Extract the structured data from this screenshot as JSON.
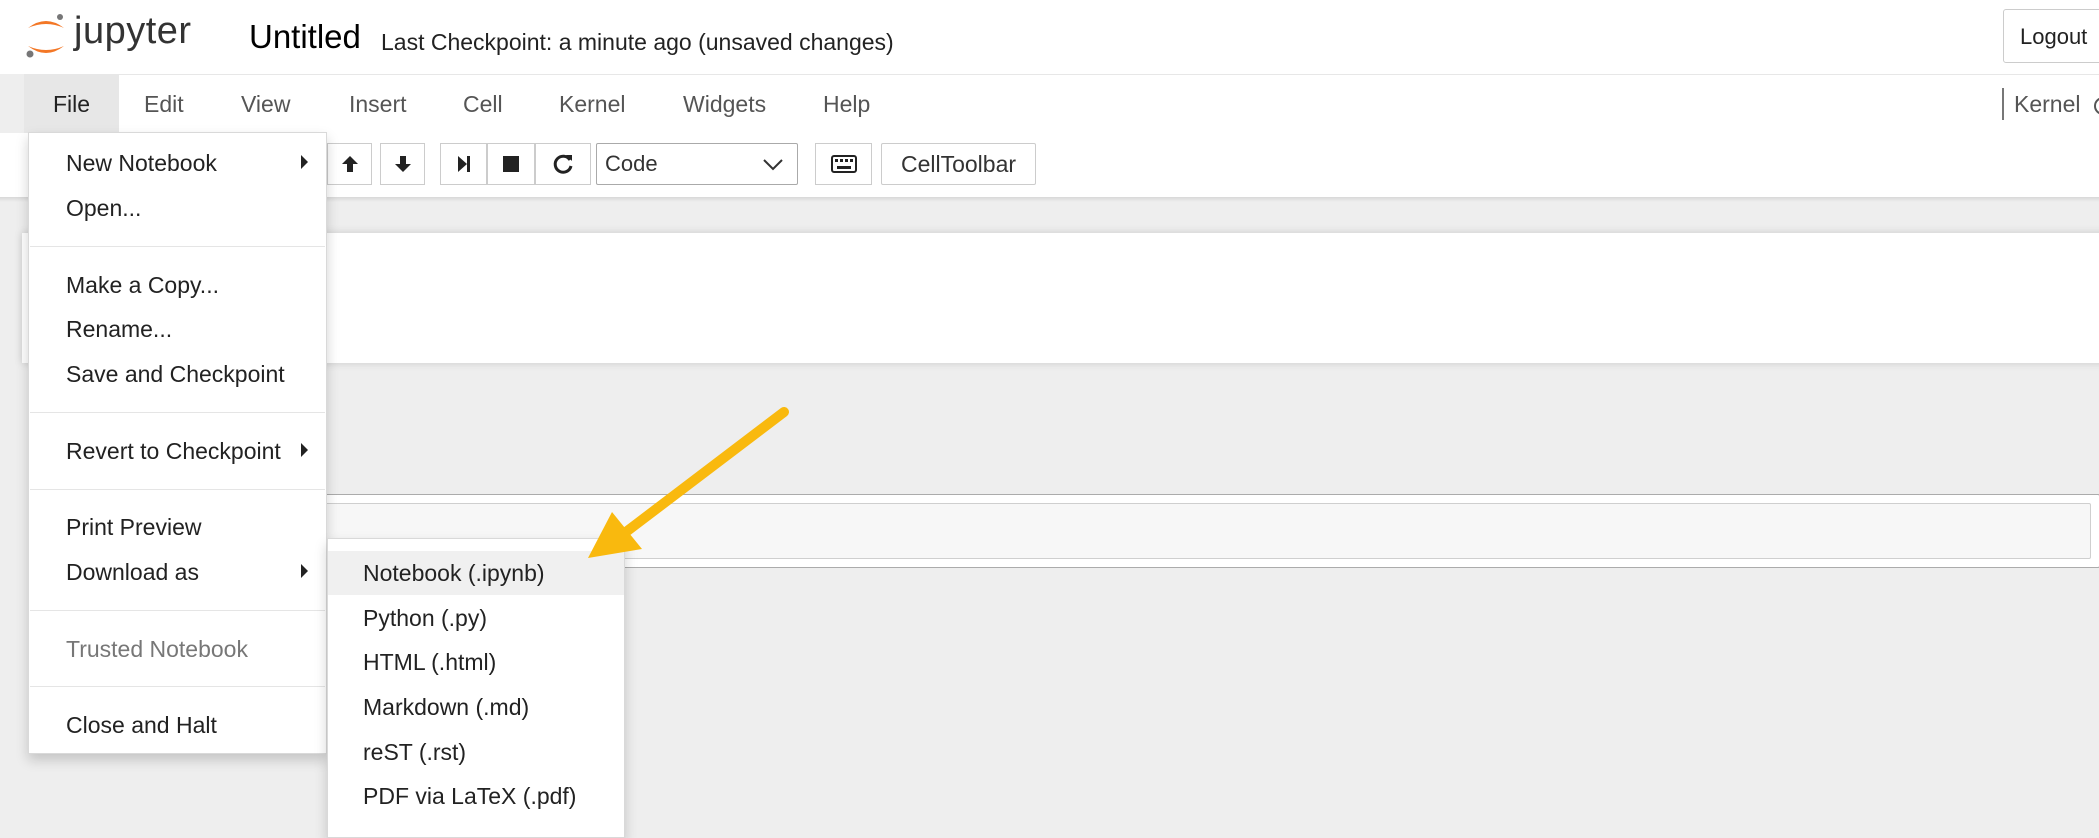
{
  "header": {
    "logo_text": "jupyter",
    "notebook_title": "Untitled",
    "checkpoint_status": "Last Checkpoint: a minute ago (unsaved changes)",
    "logout_label": "Logout"
  },
  "menubar": {
    "items": [
      {
        "label": "File",
        "active": true
      },
      {
        "label": "Edit"
      },
      {
        "label": "View"
      },
      {
        "label": "Insert"
      },
      {
        "label": "Cell"
      },
      {
        "label": "Kernel"
      },
      {
        "label": "Widgets"
      },
      {
        "label": "Help"
      }
    ],
    "kernel_label": "Kernel"
  },
  "toolbar": {
    "buttons": [
      "arrow-up-icon",
      "arrow-down-icon",
      "step-forward-icon",
      "stop-icon",
      "restart-icon",
      "keyboard-icon"
    ],
    "cell_type": "Code",
    "celltoolbar_label": "CellToolbar"
  },
  "file_menu": {
    "items": [
      {
        "label": "New Notebook",
        "submenu": true
      },
      {
        "label": "Open..."
      },
      {
        "label": "Make a Copy..."
      },
      {
        "label": "Rename..."
      },
      {
        "label": "Save and Checkpoint"
      },
      {
        "label": "Revert to Checkpoint",
        "submenu": true
      },
      {
        "label": "Print Preview"
      },
      {
        "label": "Download as",
        "submenu": true
      },
      {
        "label": "Trusted Notebook",
        "disabled": true
      },
      {
        "label": "Close and Halt"
      }
    ]
  },
  "download_submenu": {
    "items": [
      {
        "label": "Notebook (.ipynb)",
        "highlighted": true
      },
      {
        "label": "Python (.py)"
      },
      {
        "label": "HTML (.html)"
      },
      {
        "label": "Markdown (.md)"
      },
      {
        "label": "reST (.rst)"
      },
      {
        "label": "PDF via LaTeX (.pdf)"
      }
    ]
  },
  "colors": {
    "jupyter_orange": "#F37726",
    "annotation_arrow": "#F9B90E"
  }
}
